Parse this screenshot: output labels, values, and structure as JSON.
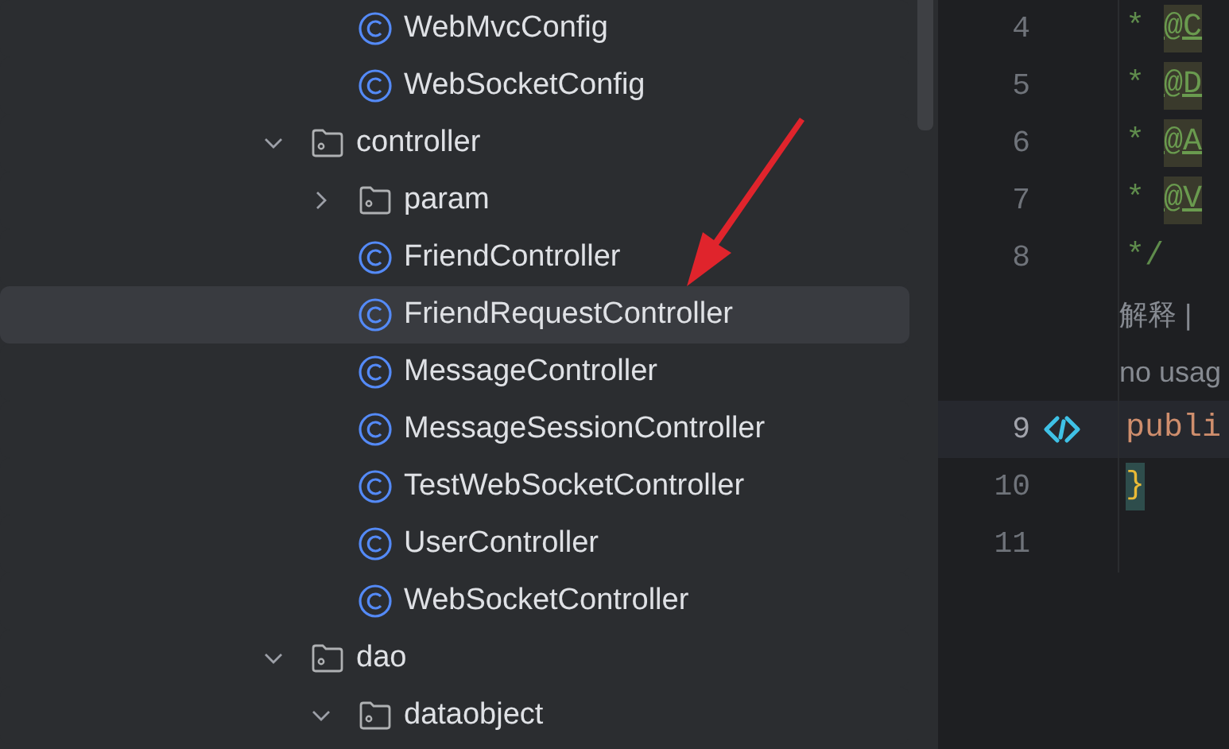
{
  "project_tree": {
    "items": [
      {
        "kind": "hidden_parent",
        "children": [
          {
            "kind": "class",
            "label": "WebMvcConfig",
            "selected": false
          },
          {
            "kind": "class",
            "label": "WebSocketConfig",
            "selected": false
          }
        ]
      },
      {
        "kind": "folder",
        "label": "controller",
        "expanded": true,
        "selected": false,
        "children": [
          {
            "kind": "folder",
            "label": "param",
            "expanded": false,
            "selected": false
          },
          {
            "kind": "class",
            "label": "FriendController",
            "selected": false
          },
          {
            "kind": "class",
            "label": "FriendRequestController",
            "selected": true
          },
          {
            "kind": "class",
            "label": "MessageController",
            "selected": false
          },
          {
            "kind": "class",
            "label": "MessageSessionController",
            "selected": false
          },
          {
            "kind": "class",
            "label": "TestWebSocketController",
            "selected": false
          },
          {
            "kind": "class",
            "label": "UserController",
            "selected": false
          },
          {
            "kind": "class",
            "label": "WebSocketController",
            "selected": false
          }
        ]
      },
      {
        "kind": "folder",
        "label": "dao",
        "expanded": true,
        "selected": false,
        "children": [
          {
            "kind": "folder",
            "label": "dataobject",
            "expanded": true,
            "selected": false
          }
        ]
      }
    ]
  },
  "editor": {
    "lines": [
      {
        "kind": "doc_tag",
        "number": "4",
        "prefix": "*",
        "text": "@C",
        "current": false,
        "marker": false
      },
      {
        "kind": "doc_tag",
        "number": "5",
        "prefix": "*",
        "text": "@D",
        "current": false,
        "marker": false
      },
      {
        "kind": "doc_tag",
        "number": "6",
        "prefix": "*",
        "text": "@A",
        "current": false,
        "marker": false
      },
      {
        "kind": "doc_tag",
        "number": "7",
        "prefix": "*",
        "text": "@V",
        "current": false,
        "marker": false
      },
      {
        "kind": "comment",
        "number": "8",
        "text": "*/",
        "current": false,
        "marker": false
      },
      {
        "kind": "hint",
        "text": "解释 |",
        "current": false,
        "marker": false
      },
      {
        "kind": "hint",
        "text": "no usag",
        "current": false,
        "marker": false
      },
      {
        "kind": "keyword",
        "number": "9",
        "text": "publi",
        "current": true,
        "marker": true
      },
      {
        "kind": "brace",
        "number": "10",
        "text": "}",
        "current": false,
        "marker": false
      },
      {
        "kind": "blank",
        "number": "11",
        "current": false,
        "marker": false
      }
    ]
  }
}
